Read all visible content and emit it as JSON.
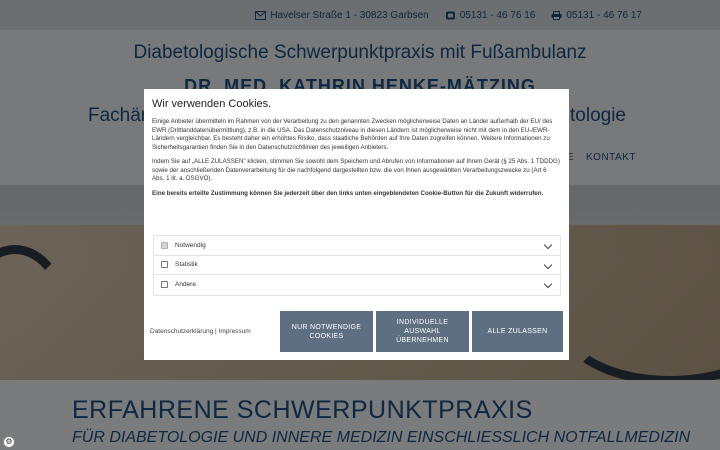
{
  "topbar": {
    "address": "Havelser Straße 1 - 30823 Garbsen",
    "phone": "05131 - 46 76 16",
    "fax": "05131 - 46 76 17",
    "icons": [
      "envelope-icon",
      "phone-icon",
      "printer-icon"
    ]
  },
  "header": {
    "title": "Diabetologische Schwerpunktpraxis mit Fußambulanz",
    "doctor": "DR. MED. KATHRIN HENKE-MÄTZING",
    "fach_left": "Fachär",
    "fach_right": "tologie",
    "nav": [
      "STE",
      "KONTAKT"
    ]
  },
  "lower": {
    "title": "ERFAHRENE SCHWERPUNKTPRAXIS",
    "subtitle": "FÜR DIABETOLOGIE UND INNERE MEDIZIN EINSCHLIESSLICH NOTFALLMEDIZIN"
  },
  "cookie": {
    "title": "Wir verwenden Cookies.",
    "p1": "Einige Anbieter übermitteln im Rahmen von der Verarbeitung zu den genannten Zwecken möglicherweise Daten an Länder außerhalb der EU/ des EWR (Drittlanddatenübermittlung), z.B. in die USA. Das Datenschutzniveau in diesen Ländern ist möglicherweise nicht mit dem in den EU-/EWR-Ländern vergleichbar. Es besteht daher ein erhöhtes Risiko, dass staatliche Behörden auf Ihre Daten zugreifen können. Weitere Informationen zu Sicherheitsgarantien finden Sie in den Datenschutzrichtlinien des jeweiligen Anbieters.",
    "p2": "Indem Sie auf „ALLE ZULASSEN\" klicken, stimmen Sie sowohl dem Speichern und Abrufen von Informationen auf Ihrem Gerät (§ 25 Abs. 1 TDDDG) sowie der anschließenden Datenverarbeitung für die nachfolgend dargestellten bzw. die von Ihnen ausgewählten Verarbeitungszwecke zu (Art 6 Abs. 1 lit. a. DSGVO).",
    "p3": "Eine bereits erteilte Zustimmung können Sie jederzeit über den links unten eingeblendeten Cookie-Button für die Zukunft widerrufen.",
    "categories": [
      {
        "label": "Notwendig",
        "checked": true,
        "disabled": true
      },
      {
        "label": "Statistik",
        "checked": false,
        "disabled": false
      },
      {
        "label": "Andere",
        "checked": false,
        "disabled": false
      }
    ],
    "links": {
      "privacy": "Datenschutzerklärung",
      "separator": "|",
      "imprint": "Impressum"
    },
    "buttons": {
      "necessary": "NUR NOTWENDIGE COOKIES",
      "individual": "INDIVIDUELLE AUSWAHL ÜBERNEHMEN",
      "all": "ALLE ZULASSEN"
    }
  },
  "colors": {
    "brand_blue": "#1c4f84",
    "button": "#5e6f82",
    "topbar": "#d6dee4"
  }
}
